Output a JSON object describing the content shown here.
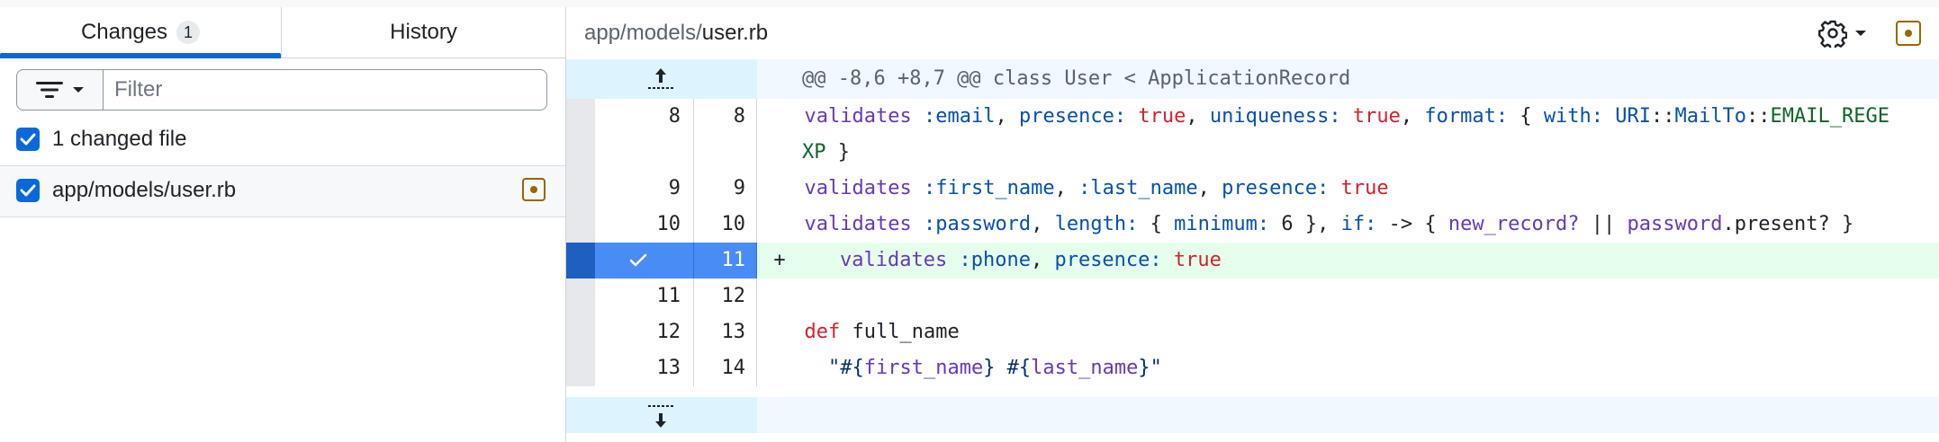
{
  "left": {
    "tabs": [
      {
        "label": "Changes",
        "count": "1",
        "active": true
      },
      {
        "label": "History",
        "active": false
      }
    ],
    "filter": {
      "placeholder": "Filter",
      "value": ""
    },
    "select_all_label": "1 changed file",
    "files": [
      {
        "path": "app/models/user.rb",
        "checked": true,
        "status_icon": "file-modified-icon"
      }
    ]
  },
  "right": {
    "header": {
      "path_dir": "app/models/",
      "path_file": "user.rb",
      "settings_icon": "gear-icon",
      "status_icon": "file-modified-icon"
    },
    "hunks": [
      {
        "header": "@@ -8,6 +8,7 @@ class User < ApplicationRecord"
      }
    ],
    "lines": [
      {
        "old": "8",
        "new": "8",
        "type": "context",
        "segments": [
          [
            "t",
            "  "
          ],
          [
            "p",
            "validates"
          ],
          [
            "t",
            " "
          ],
          [
            "s",
            ":email"
          ],
          [
            "t",
            ", "
          ],
          [
            "s",
            "presence:"
          ],
          [
            "t",
            " "
          ],
          [
            "k",
            "true"
          ],
          [
            "t",
            ", "
          ],
          [
            "s",
            "uniqueness:"
          ],
          [
            "t",
            " "
          ],
          [
            "k",
            "true"
          ],
          [
            "t",
            ", "
          ],
          [
            "s",
            "format:"
          ],
          [
            "t",
            " { "
          ],
          [
            "s",
            "with:"
          ],
          [
            "t",
            " "
          ],
          [
            "s",
            "URI"
          ],
          [
            "t",
            "::"
          ],
          [
            "s",
            "MailTo"
          ],
          [
            "t",
            "::"
          ],
          [
            "g",
            "EMAIL_REGE"
          ]
        ]
      },
      {
        "old": "",
        "new": "",
        "type": "wrap",
        "segments": [
          [
            "g",
            "XP"
          ],
          [
            "t",
            " }"
          ]
        ]
      },
      {
        "old": "9",
        "new": "9",
        "type": "context",
        "segments": [
          [
            "t",
            "  "
          ],
          [
            "p",
            "validates"
          ],
          [
            "t",
            " "
          ],
          [
            "s",
            ":first_name"
          ],
          [
            "t",
            ", "
          ],
          [
            "s",
            ":last_name"
          ],
          [
            "t",
            ", "
          ],
          [
            "s",
            "presence:"
          ],
          [
            "t",
            " "
          ],
          [
            "k",
            "true"
          ]
        ]
      },
      {
        "old": "10",
        "new": "10",
        "type": "context",
        "segments": [
          [
            "t",
            "  "
          ],
          [
            "p",
            "validates"
          ],
          [
            "t",
            " "
          ],
          [
            "s",
            ":password"
          ],
          [
            "t",
            ", "
          ],
          [
            "s",
            "length:"
          ],
          [
            "t",
            " { "
          ],
          [
            "s",
            "minimum:"
          ],
          [
            "t",
            " 6 }, "
          ],
          [
            "s",
            "if:"
          ],
          [
            "t",
            " -> { "
          ],
          [
            "p",
            "new_record?"
          ],
          [
            "t",
            " || "
          ],
          [
            "p",
            "password"
          ],
          [
            "t",
            ".present? }"
          ]
        ]
      },
      {
        "old": "",
        "new": "11",
        "type": "added",
        "marker": "+",
        "segments": [
          [
            "p",
            "validates"
          ],
          [
            "t",
            " "
          ],
          [
            "s",
            ":phone"
          ],
          [
            "t",
            ", "
          ],
          [
            "s",
            "presence:"
          ],
          [
            "t",
            " "
          ],
          [
            "k",
            "true"
          ]
        ]
      },
      {
        "old": "11",
        "new": "12",
        "type": "context",
        "segments": []
      },
      {
        "old": "12",
        "new": "13",
        "type": "context",
        "segments": [
          [
            "t",
            "  "
          ],
          [
            "k",
            "def"
          ],
          [
            "t",
            " full_name"
          ]
        ]
      },
      {
        "old": "13",
        "new": "14",
        "type": "context",
        "segments": [
          [
            "t",
            "    "
          ],
          [
            "str",
            "\"#{"
          ],
          [
            "p",
            "first_name"
          ],
          [
            "str",
            "} #{"
          ],
          [
            "p",
            "last_name"
          ],
          [
            "str",
            "}\""
          ]
        ]
      }
    ]
  }
}
